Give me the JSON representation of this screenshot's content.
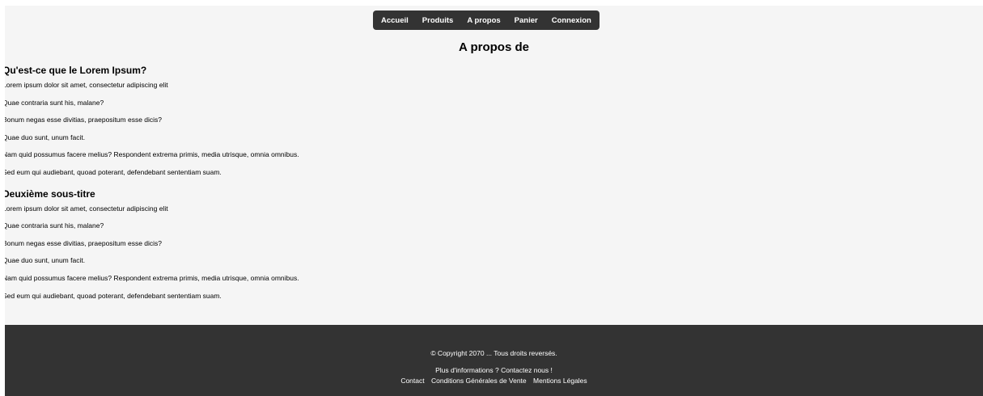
{
  "nav": {
    "items": [
      "Accueil",
      "Produits",
      "A propos",
      "Panier",
      "Connexion"
    ]
  },
  "page_title": "A propos de",
  "sections": [
    {
      "heading": "Qu'est-ce que le Lorem Ipsum?",
      "paragraphs": [
        "Lorem ipsum dolor sit amet, consectetur adipiscing elit",
        "Quae contraria sunt his, malane?",
        "Bonum negas esse divitias, praepositum esse dicis?",
        "Quae duo sunt, unum facit.",
        "Nam quid possumus facere melius? Respondent extrema primis, media utrisque, omnia omnibus.",
        "Sed eum qui audiebant, quoad poterant, defendebant sententiam suam."
      ]
    },
    {
      "heading": "Deuxième sous-titre",
      "paragraphs": [
        "Lorem ipsum dolor sit amet, consectetur adipiscing elit",
        "Quae contraria sunt his, malane?",
        "Bonum negas esse divitias, praepositum esse dicis?",
        "Quae duo sunt, unum facit.",
        "Nam quid possumus facere melius? Respondent extrema primis, media utrisque, omnia omnibus.",
        "Sed eum qui audiebant, quoad poterant, defendebant sententiam suam."
      ]
    }
  ],
  "footer": {
    "copyright": "© Copyright 2070 ... Tous droits reversés.",
    "more_info": "Plus d'informations ? Contactez nous !",
    "links": [
      "Contact",
      "Conditions Générales de Vente",
      "Mentions Légales"
    ]
  },
  "colors": {
    "nav_background": "#333333",
    "footer_background": "#333333",
    "page_background": "#f5f5f5"
  }
}
